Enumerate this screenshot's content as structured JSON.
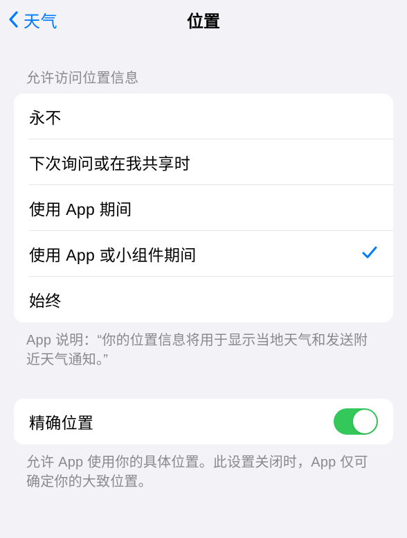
{
  "nav": {
    "back_label": "天气",
    "title": "位置"
  },
  "section1": {
    "header": "允许访问位置信息",
    "options": [
      {
        "label": "永不",
        "selected": false
      },
      {
        "label": "下次询问或在我共享时",
        "selected": false
      },
      {
        "label": "使用 App 期间",
        "selected": false
      },
      {
        "label": "使用 App 或小组件期间",
        "selected": true
      },
      {
        "label": "始终",
        "selected": false
      }
    ],
    "footer": "App 说明：“你的位置信息将用于显示当地天气和发送附近天气通知。”"
  },
  "section2": {
    "precise_label": "精确位置",
    "precise_enabled": true,
    "footer": "允许 App 使用你的具体位置。此设置关闭时，App 仅可确定你的大致位置。"
  },
  "colors": {
    "accent": "#007aff",
    "toggle_on": "#34c759",
    "bg": "#f2f2f7"
  }
}
